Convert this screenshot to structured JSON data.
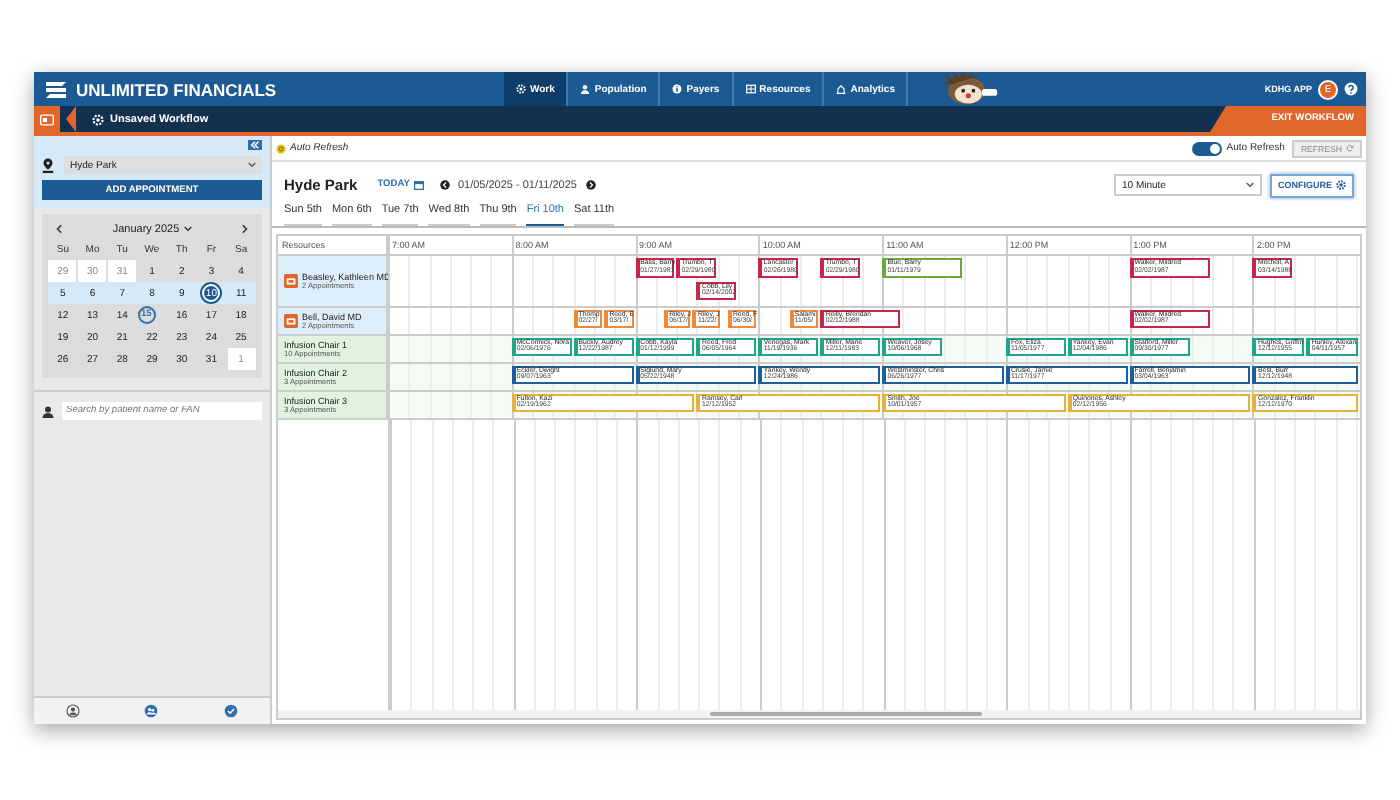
{
  "header": {
    "brand": "UNLIMITED FINANCIALS",
    "nav": [
      {
        "label": "Work",
        "selected": true
      },
      {
        "label": "Population",
        "selected": false
      },
      {
        "label": "Payers",
        "selected": false
      },
      {
        "label": "Resources",
        "selected": false
      },
      {
        "label": "Analytics",
        "selected": false
      }
    ],
    "app_label": "KDHG APP",
    "avatar": "E"
  },
  "workflow_bar": {
    "title": "Unsaved Workflow",
    "exit": "EXIT WORKFLOW"
  },
  "sidebar": {
    "location": "Hyde Park",
    "add_button": "ADD APPOINTMENT",
    "calendar": {
      "month": "January 2025",
      "weekdays": [
        "Su",
        "Mo",
        "Tu",
        "We",
        "Th",
        "Fr",
        "Sa"
      ],
      "weeks": [
        {
          "highlighted": false,
          "days": [
            {
              "label": "29",
              "outside": true,
              "selected": false,
              "today": false
            },
            {
              "label": "30",
              "outside": true,
              "selected": false,
              "today": false
            },
            {
              "label": "31",
              "outside": true,
              "selected": false,
              "today": false
            },
            {
              "label": "1",
              "outside": false,
              "selected": false,
              "today": false
            },
            {
              "label": "2",
              "outside": false,
              "selected": false,
              "today": false
            },
            {
              "label": "3",
              "outside": false,
              "selected": false,
              "today": false
            },
            {
              "label": "4",
              "outside": false,
              "selected": false,
              "today": false
            }
          ]
        },
        {
          "highlighted": true,
          "days": [
            {
              "label": "5",
              "outside": false,
              "selected": false,
              "today": false
            },
            {
              "label": "6",
              "outside": false,
              "selected": false,
              "today": false
            },
            {
              "label": "7",
              "outside": false,
              "selected": false,
              "today": false
            },
            {
              "label": "8",
              "outside": false,
              "selected": false,
              "today": false
            },
            {
              "label": "9",
              "outside": false,
              "selected": false,
              "today": false
            },
            {
              "label": "10",
              "outside": false,
              "selected": true,
              "today": false
            },
            {
              "label": "11",
              "outside": false,
              "selected": false,
              "today": false
            }
          ]
        },
        {
          "highlighted": false,
          "days": [
            {
              "label": "12",
              "outside": false,
              "selected": false,
              "today": false
            },
            {
              "label": "13",
              "outside": false,
              "selected": false,
              "today": false
            },
            {
              "label": "14",
              "outside": false,
              "selected": false,
              "today": false
            },
            {
              "label": "15",
              "outside": false,
              "selected": false,
              "today": true
            },
            {
              "label": "16",
              "outside": false,
              "selected": false,
              "today": false
            },
            {
              "label": "17",
              "outside": false,
              "selected": false,
              "today": false
            },
            {
              "label": "18",
              "outside": false,
              "selected": false,
              "today": false
            }
          ]
        },
        {
          "highlighted": false,
          "days": [
            {
              "label": "19",
              "outside": false,
              "selected": false,
              "today": false
            },
            {
              "label": "20",
              "outside": false,
              "selected": false,
              "today": false
            },
            {
              "label": "21",
              "outside": false,
              "selected": false,
              "today": false
            },
            {
              "label": "22",
              "outside": false,
              "selected": false,
              "today": false
            },
            {
              "label": "23",
              "outside": false,
              "selected": false,
              "today": false
            },
            {
              "label": "24",
              "outside": false,
              "selected": false,
              "today": false
            },
            {
              "label": "25",
              "outside": false,
              "selected": false,
              "today": false
            }
          ]
        },
        {
          "highlighted": false,
          "days": [
            {
              "label": "26",
              "outside": false,
              "selected": false,
              "today": false
            },
            {
              "label": "27",
              "outside": false,
              "selected": false,
              "today": false
            },
            {
              "label": "28",
              "outside": false,
              "selected": false,
              "today": false
            },
            {
              "label": "29",
              "outside": false,
              "selected": false,
              "today": false
            },
            {
              "label": "30",
              "outside": false,
              "selected": false,
              "today": false
            },
            {
              "label": "31",
              "outside": false,
              "selected": false,
              "today": false
            },
            {
              "label": "1",
              "outside": true,
              "selected": false,
              "today": false
            }
          ]
        }
      ]
    },
    "search": {
      "placeholder": "Search by patient name or FAN"
    }
  },
  "toolbar": {
    "note": "Auto Refresh",
    "toggle": {
      "label": "Auto Refresh",
      "on": true
    },
    "refresh": "REFRESH"
  },
  "schedule": {
    "location": "Hyde Park",
    "today": "TODAY",
    "range": "01/05/2025 - 01/11/2025",
    "interval": "10 Minute",
    "configure": "CONFIGURE",
    "days": [
      {
        "label": "Sun 5th",
        "selected": false
      },
      {
        "label": "Mon 6th",
        "selected": false
      },
      {
        "label": "Tue 7th",
        "selected": false
      },
      {
        "label": "Wed 8th",
        "selected": false
      },
      {
        "label": "Thu 9th",
        "selected": false
      },
      {
        "label": "Fri 10th",
        "selected": true
      },
      {
        "label": "Sat 11th",
        "selected": false
      }
    ],
    "resources_heading": "Resources",
    "times": [
      "7:00 AM",
      "8:00 AM",
      "9:00 AM",
      "10:00 AM",
      "11:00 AM",
      "12:00 PM",
      "1:00 PM",
      "2:00 PM"
    ],
    "rows": [
      {
        "kind": "provider",
        "name": "Beasley, Kathleen MD",
        "count": "2 Appointments",
        "appointments": [
          {
            "name": "Bass, Barry",
            "dob": "01/27/1981",
            "color": "#c8254b"
          },
          {
            "name": "Trumbo, T",
            "dob": "02/29/1980",
            "color": "#c8254b"
          },
          {
            "name": "Cobb, Lily",
            "dob": "02/14/2002",
            "color": "#c8254b"
          },
          {
            "name": "Lancaster",
            "dob": "02/26/1980",
            "color": "#c8254b"
          },
          {
            "name": "Trumbo, T",
            "dob": "02/29/1980",
            "color": "#c8254b"
          },
          {
            "name": "Blue, Barry",
            "dob": "01/11/1979",
            "color": "#6aaa3a"
          },
          {
            "name": "Walker, Mildred",
            "dob": "02/02/1987",
            "color": "#c8254b"
          },
          {
            "name": "Mitchell, A",
            "dob": "03/14/1988",
            "color": "#c8254b"
          }
        ]
      },
      {
        "kind": "provider",
        "name": "Bell, David MD",
        "count": "2 Appointments",
        "appointments": [
          {
            "name": "Thomp",
            "dob": "02/27/",
            "color": "#ee8a3c"
          },
          {
            "name": "Reed, E",
            "dob": "03/17/",
            "color": "#ee8a3c"
          },
          {
            "name": "Riley, J",
            "dob": "06/17/",
            "color": "#ee8a3c"
          },
          {
            "name": "Riley, J",
            "dob": "11/22/",
            "color": "#ee8a3c"
          },
          {
            "name": "Reed, F",
            "dob": "06/30/",
            "color": "#ee8a3c"
          },
          {
            "name": "Salami",
            "dob": "11/05/",
            "color": "#ee8a3c"
          },
          {
            "name": "Reilly, Brendan",
            "dob": "02/12/1988",
            "color": "#c8254b"
          },
          {
            "name": "Walker, Mildred",
            "dob": "02/02/1987",
            "color": "#c8254b"
          }
        ]
      },
      {
        "kind": "chair",
        "name": "Infusion Chair 1",
        "count": "10 Appointments",
        "appointments": [
          {
            "name": "McCormick, Nora",
            "dob": "02/06/1976",
            "color": "#1fa58c"
          },
          {
            "name": "Buckly, Audrey",
            "dob": "12/22/1987",
            "color": "#1fa58c"
          },
          {
            "name": "Cobb, Kayla",
            "dob": "01/12/1999",
            "color": "#1fa58c"
          },
          {
            "name": "Reed, Fred",
            "dob": "06/05/1964",
            "color": "#1fa58c"
          },
          {
            "name": "Venegas, Mark",
            "dob": "11/19/1936",
            "color": "#1fa58c"
          },
          {
            "name": "Miller, Marie",
            "dob": "12/11/1983",
            "color": "#1fa58c"
          },
          {
            "name": "Weaver, Josey",
            "dob": "10/06/1968",
            "color": "#1fa58c"
          },
          {
            "name": "Fox, Eliza",
            "dob": "11/05/1977",
            "color": "#1fa58c"
          },
          {
            "name": "Yankey, Evan",
            "dob": "12/04/1986",
            "color": "#1fa58c"
          },
          {
            "name": "Stafford, Miller",
            "dob": "09/30/1977",
            "color": "#1fa58c"
          },
          {
            "name": "Hughes, Griffin",
            "dob": "12/12/1955",
            "color": "#1fa58c"
          },
          {
            "name": "Hunley, Alexan",
            "dob": "04/11/1957",
            "color": "#1fa58c"
          }
        ]
      },
      {
        "kind": "chair",
        "name": "Infusion Chair 2",
        "count": "3 Appointments",
        "appointments": [
          {
            "name": "Eckler, Dwight",
            "dob": "09/07/1963",
            "color": "#1f5d9c"
          },
          {
            "name": "Siglund, Mary",
            "dob": "05/22/1948",
            "color": "#1f5d9c"
          },
          {
            "name": "Yankey, Wendy",
            "dob": "12/24/1986",
            "color": "#1f5d9c"
          },
          {
            "name": "Westminster, Chris",
            "dob": "06/26/1977",
            "color": "#1f5d9c"
          },
          {
            "name": "Crusie, Jamie",
            "dob": "11/17/1977",
            "color": "#1f5d9c"
          },
          {
            "name": "Farrell, Benjamin",
            "dob": "03/04/1963",
            "color": "#1f5d9c"
          },
          {
            "name": "Best, Burr",
            "dob": "12/12/1948",
            "color": "#1f5d9c"
          }
        ]
      },
      {
        "kind": "chair",
        "name": "Infusion Chair 3",
        "count": "3 Appointments",
        "appointments": [
          {
            "name": "Fulton, Kazi",
            "dob": "02/19/1962",
            "color": "#e8b23a"
          },
          {
            "name": "Ramsey, Carl",
            "dob": "12/12/1952",
            "color": "#e8b23a"
          },
          {
            "name": "Smith, Joe",
            "dob": "10/01/1957",
            "color": "#e8b23a"
          },
          {
            "name": "Quinones, Ashley",
            "dob": "02/12/1956",
            "color": "#e8b23a"
          },
          {
            "name": "Gonzalez, Franklin",
            "dob": "12/12/1970",
            "color": "#e8b23a"
          }
        ]
      }
    ]
  }
}
